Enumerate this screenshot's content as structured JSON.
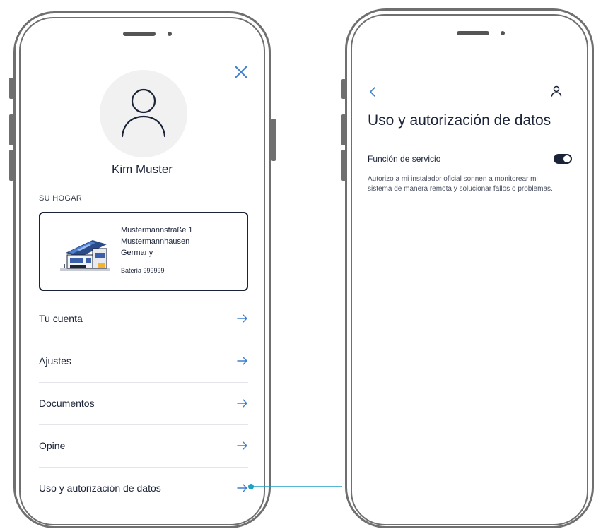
{
  "left_screen": {
    "user_name": "Kim Muster",
    "section_label": "SU HOGAR",
    "home": {
      "address_line1": "Mustermannstraße 1",
      "address_line2": "Mustermannhausen",
      "address_line3": "Germany",
      "battery": "Batería 999999"
    },
    "menu": [
      {
        "label": "Tu cuenta"
      },
      {
        "label": "Ajustes"
      },
      {
        "label": "Documentos"
      },
      {
        "label": "Opine"
      },
      {
        "label": "Uso y autorización de datos"
      }
    ]
  },
  "right_screen": {
    "title": "Uso y autorización de datos",
    "setting": {
      "label": "Función de servicio",
      "enabled": true,
      "description": "Autorizo a mi instalador oficial sonnen a monitorear mi sistema de manera remota y solucionar fallos o problemas."
    }
  },
  "colors": {
    "text": "#1b2338",
    "close_icon": "#3d7fd1",
    "arrow_icon": "#3d7fd1",
    "connector": "#1fa0c9",
    "phone_frame": "#6f6f6f"
  },
  "icons": [
    "close-icon",
    "person-icon",
    "house-illustration",
    "arrow-right-icon",
    "back-chevron-icon",
    "profile-icon",
    "toggle-switch"
  ]
}
